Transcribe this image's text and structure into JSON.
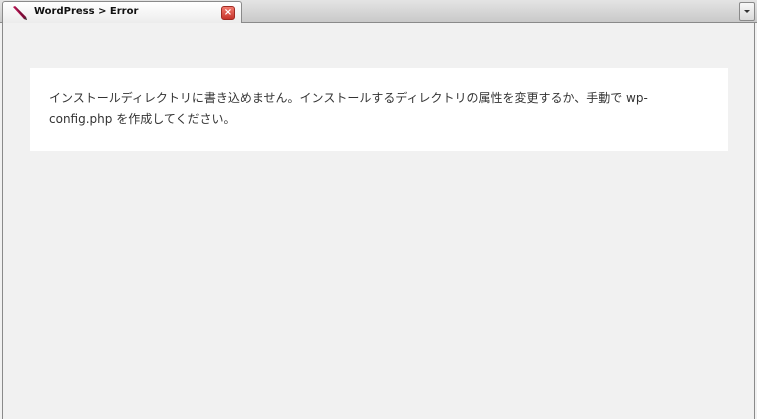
{
  "tab": {
    "title": "WordPress > Error",
    "icon": "wordpress-quill-icon",
    "close_glyph": "×"
  },
  "tab_menu": {
    "icon": "chevron-down-icon"
  },
  "error": {
    "message": "インストールディレクトリに書き込めません。インストールするディレクトリの属性を変更するか、手動で wp-config.php を作成してください。"
  },
  "colors": {
    "page_background": "#f1f1f1",
    "box_background": "#ffffff",
    "text": "#333333",
    "close_button": "#d9453a"
  }
}
